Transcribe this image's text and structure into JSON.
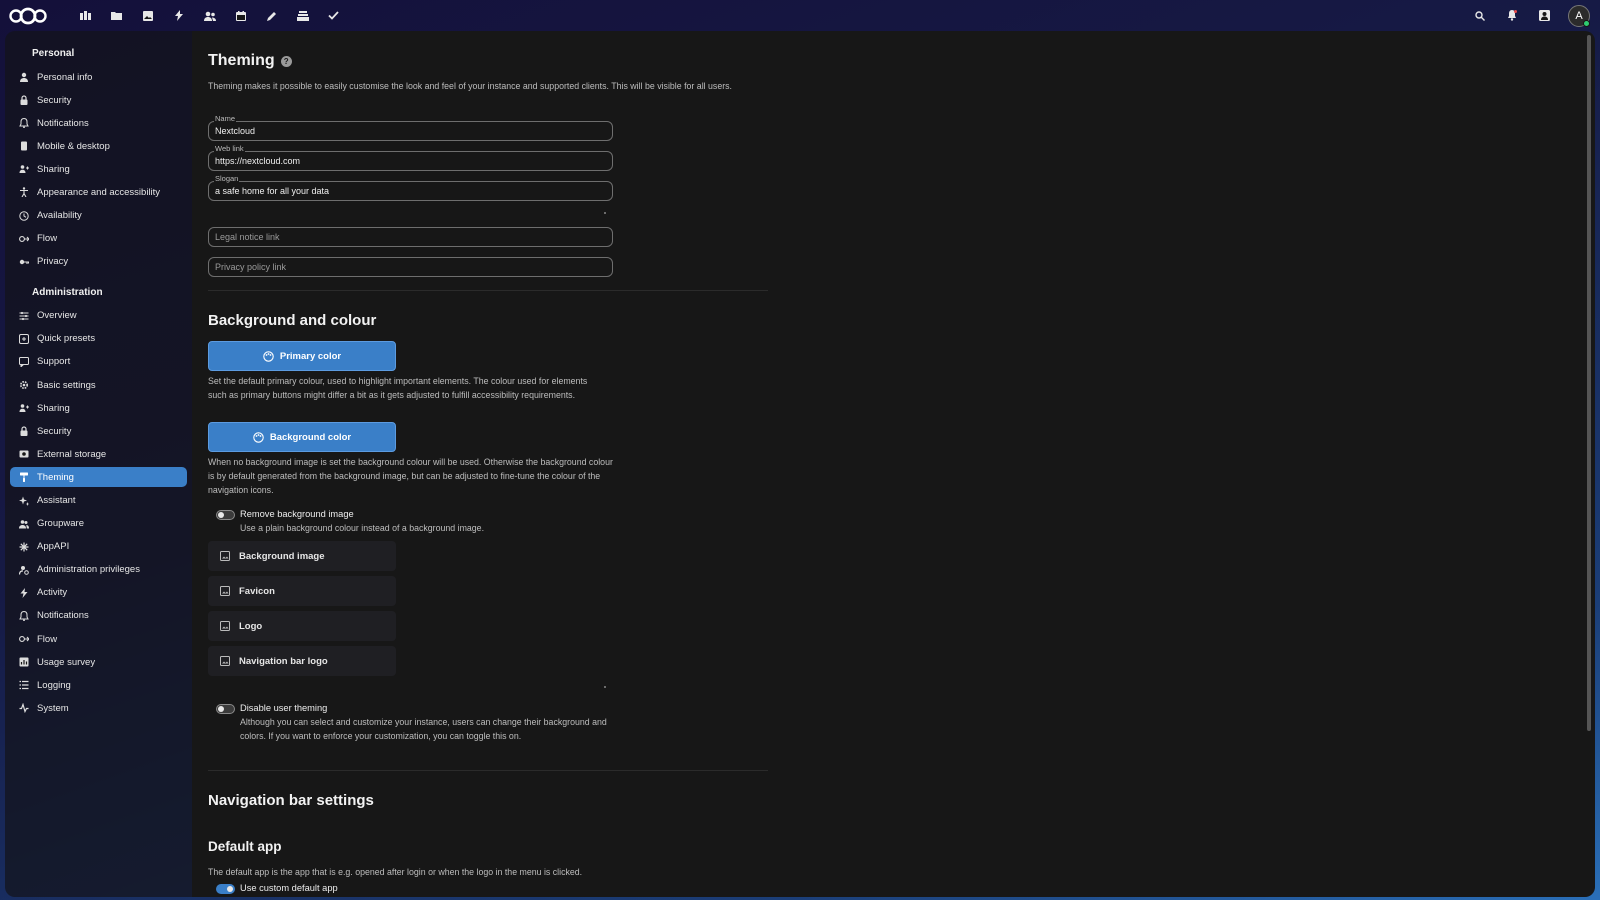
{
  "header": {
    "apps": [
      {
        "name": "dashboard",
        "icon": "dashboard-icon"
      },
      {
        "name": "files",
        "icon": "folder-icon"
      },
      {
        "name": "photos",
        "icon": "image-icon"
      },
      {
        "name": "activity",
        "icon": "bolt-icon"
      },
      {
        "name": "contacts",
        "icon": "contacts-icon"
      },
      {
        "name": "calendar",
        "icon": "calendar-icon"
      },
      {
        "name": "notes",
        "icon": "pencil-icon"
      },
      {
        "name": "deck",
        "icon": "deck-icon"
      },
      {
        "name": "tasks",
        "icon": "check-icon"
      }
    ],
    "avatar_letter": "A"
  },
  "sidebar": {
    "personal_caption": "Personal",
    "personal_items": [
      {
        "label": "Personal info",
        "icon": "user-icon"
      },
      {
        "label": "Security",
        "icon": "lock-icon"
      },
      {
        "label": "Notifications",
        "icon": "bell-icon"
      },
      {
        "label": "Mobile & desktop",
        "icon": "phone-icon"
      },
      {
        "label": "Sharing",
        "icon": "share-icon"
      },
      {
        "label": "Appearance and accessibility",
        "icon": "accessibility-icon"
      },
      {
        "label": "Availability",
        "icon": "clock-icon"
      },
      {
        "label": "Flow",
        "icon": "flow-icon"
      },
      {
        "label": "Privacy",
        "icon": "key-icon"
      }
    ],
    "admin_caption": "Administration",
    "admin_items": [
      {
        "label": "Overview",
        "icon": "sliders-icon"
      },
      {
        "label": "Quick presets",
        "icon": "presets-icon"
      },
      {
        "label": "Support",
        "icon": "support-icon"
      },
      {
        "label": "Basic settings",
        "icon": "gear-icon"
      },
      {
        "label": "Sharing",
        "icon": "share-icon"
      },
      {
        "label": "Security",
        "icon": "lock-icon"
      },
      {
        "label": "External storage",
        "icon": "storage-icon"
      },
      {
        "label": "Theming",
        "icon": "brush-icon",
        "active": true
      },
      {
        "label": "Assistant",
        "icon": "sparkle-icon"
      },
      {
        "label": "Groupware",
        "icon": "group-icon"
      },
      {
        "label": "AppAPI",
        "icon": "api-icon"
      },
      {
        "label": "Administration privileges",
        "icon": "admin-icon"
      },
      {
        "label": "Activity",
        "icon": "bolt-icon"
      },
      {
        "label": "Notifications",
        "icon": "bell-icon"
      },
      {
        "label": "Flow",
        "icon": "flow-icon"
      },
      {
        "label": "Usage survey",
        "icon": "chart-icon"
      },
      {
        "label": "Logging",
        "icon": "list-icon"
      },
      {
        "label": "System",
        "icon": "pulse-icon"
      }
    ]
  },
  "main": {
    "title": "Theming",
    "description": "Theming makes it possible to easily customise the look and feel of your instance and supported clients. This will be visible for all users.",
    "fields": {
      "name": {
        "label": "Name",
        "value": "Nextcloud"
      },
      "web_link": {
        "label": "Web link",
        "value": "https://nextcloud.com"
      },
      "slogan": {
        "label": "Slogan",
        "value": "a safe home for all your data"
      },
      "legal_notice": {
        "placeholder": "Legal notice link"
      },
      "privacy_policy": {
        "placeholder": "Privacy policy link"
      }
    },
    "background_section": {
      "title": "Background and colour",
      "primary_button": "Primary color",
      "primary_desc": "Set the default primary colour, used to highlight important elements. The colour used for elements such as primary buttons might differ a bit as it gets adjusted to fulfill accessibility requirements.",
      "background_button": "Background color",
      "background_desc": "When no background image is set the background colour will be used. Otherwise the background colour is by default generated from the background image, but can be adjusted to fine-tune the colour of the navigation icons.",
      "remove_bg_label": "Remove background image",
      "remove_bg_desc": "Use a plain background colour instead of a background image.",
      "image_buttons": [
        "Background image",
        "Favicon",
        "Logo",
        "Navigation bar logo"
      ],
      "disable_theming_label": "Disable user theming",
      "disable_theming_desc": "Although you can select and customize your instance, users can change their background and colors. If you want to enforce your customization, you can toggle this on."
    },
    "nav_section": {
      "title": "Navigation bar settings",
      "default_app_title": "Default app",
      "default_app_desc": "The default app is the app that is e.g. opened after login or when the logo in the menu is clicked.",
      "custom_default_label": "Use custom default app"
    }
  }
}
